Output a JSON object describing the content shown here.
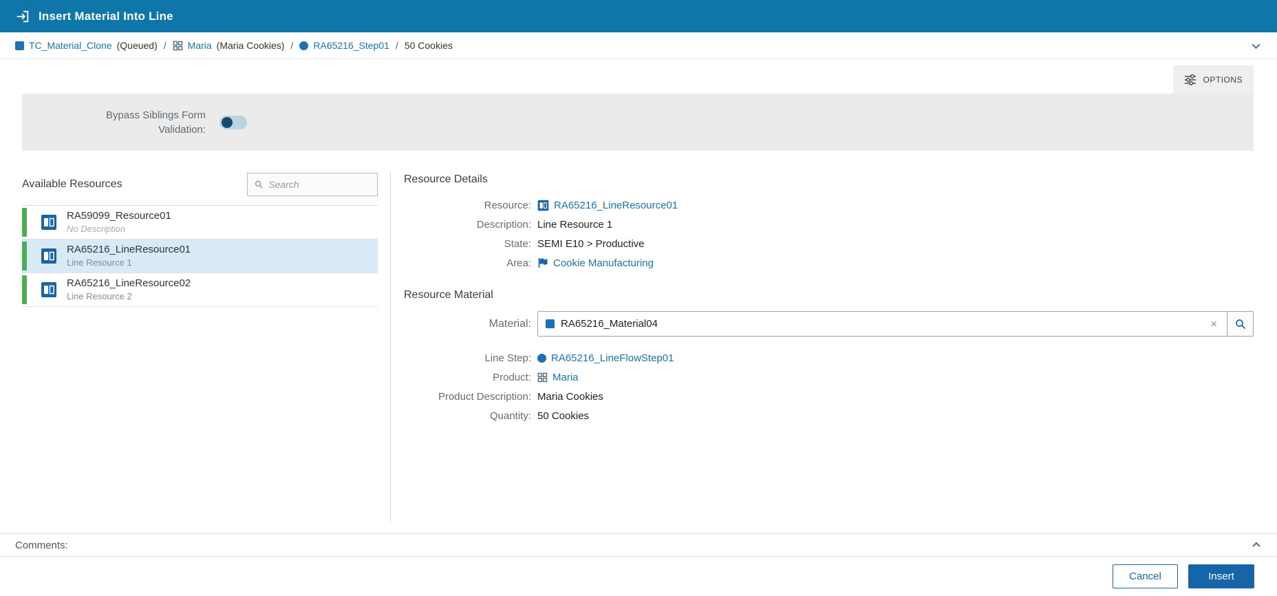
{
  "header": {
    "title": "Insert Material Into Line"
  },
  "breadcrumb": {
    "separator": "/",
    "items": [
      {
        "label": "TC_Material_Clone",
        "suffix": "(Queued)"
      },
      {
        "label": "Maria",
        "suffix": "(Maria Cookies)"
      },
      {
        "label": "RA65216_Step01",
        "suffix": ""
      },
      {
        "label": "50 Cookies",
        "suffix": ""
      }
    ]
  },
  "options_button": {
    "label": "OPTIONS"
  },
  "bypass": {
    "label_line1": "Bypass Siblings Form",
    "label_line2": "Validation:",
    "state": "off"
  },
  "resources": {
    "title": "Available Resources",
    "search_placeholder": "Search",
    "selected_index": 1,
    "items": [
      {
        "name": "RA59099_Resource01",
        "description": "No Description"
      },
      {
        "name": "RA65216_LineResource01",
        "description": "Line Resource 1"
      },
      {
        "name": "RA65216_LineResource02",
        "description": "Line Resource 2"
      }
    ]
  },
  "resource_details": {
    "title": "Resource Details",
    "rows": [
      {
        "label": "Resource:",
        "value": "RA65216_LineResource01"
      },
      {
        "label": "Description:",
        "value": "Line Resource 1"
      },
      {
        "label": "State:",
        "value": "SEMI E10 > Productive"
      },
      {
        "label": "Area:",
        "value": "Cookie Manufacturing"
      }
    ]
  },
  "resource_material": {
    "title": "Resource Material",
    "material_label": "Material:",
    "material_value": "RA65216_Material04",
    "clear_icon": "×",
    "rows": [
      {
        "label": "Line Step:",
        "value": "RA65216_LineFlowStep01"
      },
      {
        "label": "Product:",
        "value": "Maria"
      },
      {
        "label": "Product Description:",
        "value": "Maria Cookies"
      },
      {
        "label": "Quantity:",
        "value": "50 Cookies"
      }
    ]
  },
  "comments": {
    "label": "Comments:"
  },
  "footer": {
    "cancel_label": "Cancel",
    "insert_label": "Insert"
  },
  "colors": {
    "primary": "#0E76A8",
    "link": "#1B72B4",
    "button": "#1565A8",
    "selected_bg": "#D8E9F7",
    "status_green": "#4CAF50"
  }
}
